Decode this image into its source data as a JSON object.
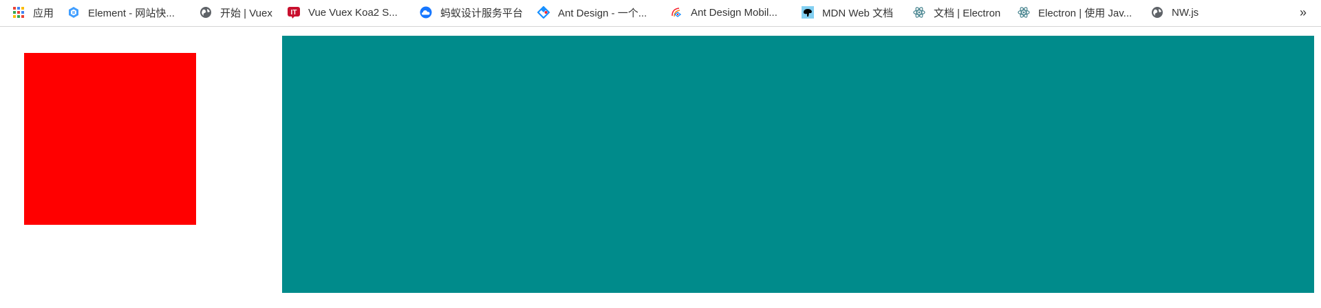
{
  "bookmarks_bar": {
    "items": [
      {
        "label": "应用",
        "icon": "apps-grid-icon"
      },
      {
        "label": "Element - 网站快...",
        "icon": "element-logo-icon"
      },
      {
        "label": "开始 | Vuex",
        "icon": "globe-icon"
      },
      {
        "label": "Vue Vuex Koa2 S...",
        "icon": "it-logo-icon"
      },
      {
        "label": "蚂蚁设计服务平台",
        "icon": "cloud-icon"
      },
      {
        "label": "Ant Design - 一个...",
        "icon": "ant-design-logo-icon"
      },
      {
        "label": "Ant Design Mobil...",
        "icon": "ant-mobile-logo-icon"
      },
      {
        "label": "MDN Web 文档",
        "icon": "mdn-dino-icon"
      },
      {
        "label": "文档 | Electron",
        "icon": "electron-logo-icon"
      },
      {
        "label": "Electron | 使用 Jav...",
        "icon": "electron-logo-icon"
      },
      {
        "label": "NW.js",
        "icon": "globe-icon"
      }
    ],
    "overflow": "»"
  },
  "content": {
    "red_box_color": "#ff0000",
    "teal_box_color": "#008b8b"
  }
}
